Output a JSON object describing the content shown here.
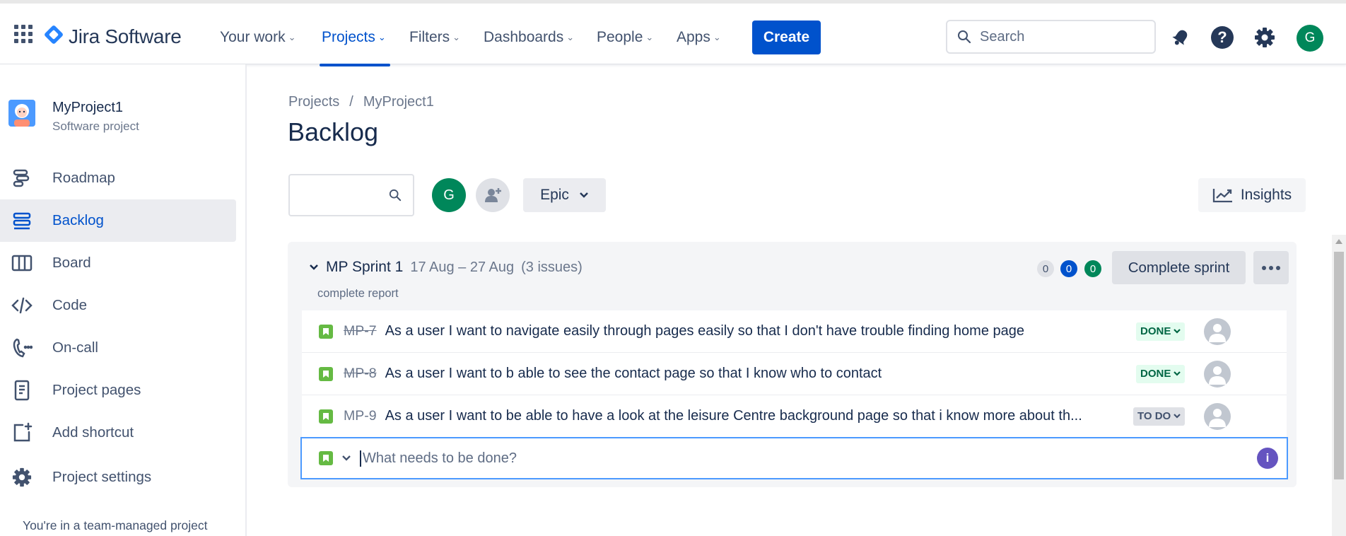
{
  "header": {
    "app_name": "Jira Software",
    "nav": [
      {
        "label": "Your work"
      },
      {
        "label": "Projects"
      },
      {
        "label": "Filters"
      },
      {
        "label": "Dashboards"
      },
      {
        "label": "People"
      },
      {
        "label": "Apps"
      }
    ],
    "active_nav": "Projects",
    "create_label": "Create",
    "search_placeholder": "Search",
    "user_initial": "G",
    "icons": [
      "app-switcher-icon",
      "notifications-icon",
      "help-icon",
      "settings-icon"
    ]
  },
  "sidebar": {
    "project_name": "MyProject1",
    "project_type": "Software project",
    "items": [
      {
        "label": "Roadmap",
        "icon": "roadmap-icon"
      },
      {
        "label": "Backlog",
        "icon": "backlog-icon",
        "active": true
      },
      {
        "label": "Board",
        "icon": "board-icon"
      },
      {
        "label": "Code",
        "icon": "code-icon"
      },
      {
        "label": "On-call",
        "icon": "phone-icon"
      },
      {
        "label": "Project pages",
        "icon": "page-icon"
      },
      {
        "label": "Add shortcut",
        "icon": "add-shortcut-icon"
      },
      {
        "label": "Project settings",
        "icon": "gear-icon"
      }
    ],
    "footer_note": "You're in a team-managed project"
  },
  "main": {
    "breadcrumb": [
      "Projects",
      "MyProject1"
    ],
    "breadcrumb_sep": "/",
    "title": "Backlog",
    "filter_avatar_initial": "G",
    "epic_label": "Epic",
    "insights_label": "Insights"
  },
  "sprint": {
    "name": "MP Sprint 1",
    "dates": "17 Aug – 27 Aug",
    "issue_count": "(3 issues)",
    "report_link": "complete report",
    "counts": {
      "todo": "0",
      "in_progress": "0",
      "done": "0"
    },
    "complete_label": "Complete sprint",
    "issues": [
      {
        "key": "MP-7",
        "summary": "As a user I want to navigate easily through pages easily so that I don't have trouble finding home page",
        "status": "DONE",
        "done": true
      },
      {
        "key": "MP-8",
        "summary": "As a user I want to b able to see the contact page so that I know who to contact",
        "status": "DONE",
        "done": true
      },
      {
        "key": "MP-9",
        "summary": "As a user I want to be able to have a look at the leisure Centre background page so that i know more about th...",
        "status": "TO DO",
        "done": false
      }
    ],
    "create_placeholder": "What needs to be done?",
    "colors": {
      "done_bg": "#E3FCEF",
      "done_text": "#006644",
      "todo_bg": "#DFE1E6",
      "accent": "#0052CC",
      "story": "#65BA43"
    }
  }
}
